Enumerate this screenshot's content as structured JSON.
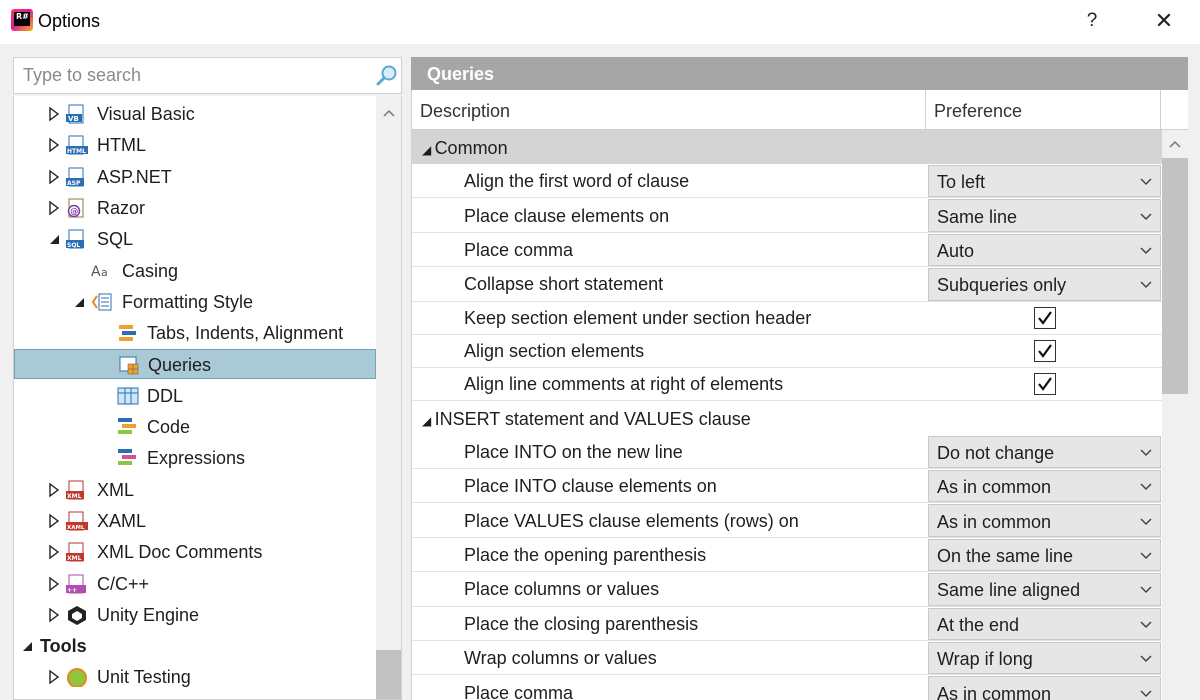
{
  "window": {
    "title": "Options",
    "help_label": "?",
    "close_label": "✕"
  },
  "search": {
    "placeholder": "Type to search"
  },
  "tree": [
    {
      "label": "Visual Basic",
      "icon": "vb-file-icon",
      "level": 1,
      "expander": "collapsed"
    },
    {
      "label": "HTML",
      "icon": "html-file-icon",
      "level": 1,
      "expander": "collapsed"
    },
    {
      "label": "ASP.NET",
      "icon": "asp-file-icon",
      "level": 1,
      "expander": "collapsed"
    },
    {
      "label": "Razor",
      "icon": "razor-file-icon",
      "level": 1,
      "expander": "collapsed"
    },
    {
      "label": "SQL",
      "icon": "sql-file-icon",
      "level": 1,
      "expander": "expanded"
    },
    {
      "label": "Casing",
      "icon": "casing-icon",
      "level": 2,
      "expander": "none"
    },
    {
      "label": "Formatting Style",
      "icon": "formatting-style-icon",
      "level": 2,
      "expander": "expanded"
    },
    {
      "label": "Tabs, Indents, Alignment",
      "icon": "tabs-indents-icon",
      "level": 3,
      "expander": "none"
    },
    {
      "label": "Queries",
      "icon": "queries-icon",
      "level": 3,
      "expander": "none",
      "selected": true
    },
    {
      "label": "DDL",
      "icon": "ddl-icon",
      "level": 3,
      "expander": "none"
    },
    {
      "label": "Code",
      "icon": "code-icon",
      "level": 3,
      "expander": "none"
    },
    {
      "label": "Expressions",
      "icon": "expressions-icon",
      "level": 3,
      "expander": "none"
    },
    {
      "label": "XML",
      "icon": "xml-file-icon",
      "level": 1,
      "expander": "collapsed"
    },
    {
      "label": "XAML",
      "icon": "xaml-file-icon",
      "level": 1,
      "expander": "collapsed"
    },
    {
      "label": "XML Doc Comments",
      "icon": "xml-doc-icon",
      "level": 1,
      "expander": "collapsed"
    },
    {
      "label": "C/C++",
      "icon": "cpp-file-icon",
      "level": 1,
      "expander": "collapsed"
    },
    {
      "label": "Unity Engine",
      "icon": "unity-icon",
      "level": 1,
      "expander": "collapsed"
    },
    {
      "label": "Tools",
      "icon": "",
      "level": 0,
      "expander": "expanded",
      "bold": true
    },
    {
      "label": "Unit Testing",
      "icon": "unit-testing-icon",
      "level": 1,
      "expander": "collapsed"
    }
  ],
  "panel": {
    "title": "Queries",
    "col_description": "Description",
    "col_preference": "Preference"
  },
  "rows": [
    {
      "type": "section",
      "label": "Common"
    },
    {
      "type": "dropdown",
      "label": "Align the first word of clause",
      "value": "To left"
    },
    {
      "type": "dropdown",
      "label": "Place clause elements on",
      "value": "Same line"
    },
    {
      "type": "dropdown",
      "label": "Place comma",
      "value": "Auto"
    },
    {
      "type": "dropdown",
      "label": "Collapse short statement",
      "value": "Subqueries only"
    },
    {
      "type": "checkbox",
      "label": "Keep section element under section header",
      "checked": true
    },
    {
      "type": "checkbox",
      "label": "Align section elements",
      "checked": true
    },
    {
      "type": "checkbox",
      "label": "Align line comments at right of elements",
      "checked": true
    },
    {
      "type": "section",
      "label": "INSERT statement and VALUES clause",
      "light": true
    },
    {
      "type": "dropdown",
      "label": "Place INTO on the new line",
      "value": "Do not change"
    },
    {
      "type": "dropdown",
      "label": "Place INTO clause elements on",
      "value": "As in common"
    },
    {
      "type": "dropdown",
      "label": "Place VALUES clause elements (rows) on",
      "value": "As in common"
    },
    {
      "type": "dropdown",
      "label": "Place the opening parenthesis",
      "value": "On the same line"
    },
    {
      "type": "dropdown",
      "label": "Place columns or values",
      "value": "Same line aligned"
    },
    {
      "type": "dropdown",
      "label": "Place the closing parenthesis",
      "value": "At the end"
    },
    {
      "type": "dropdown",
      "label": "Wrap columns or values",
      "value": "Wrap if long"
    },
    {
      "type": "dropdown",
      "label": "Place comma",
      "value": "As in common"
    }
  ],
  "colors": {
    "selection": "#a9c9d6",
    "panel_header": "#a6a6a6",
    "section_bg": "#d4d4d4",
    "dropdown_bg": "#e6e6e6"
  }
}
